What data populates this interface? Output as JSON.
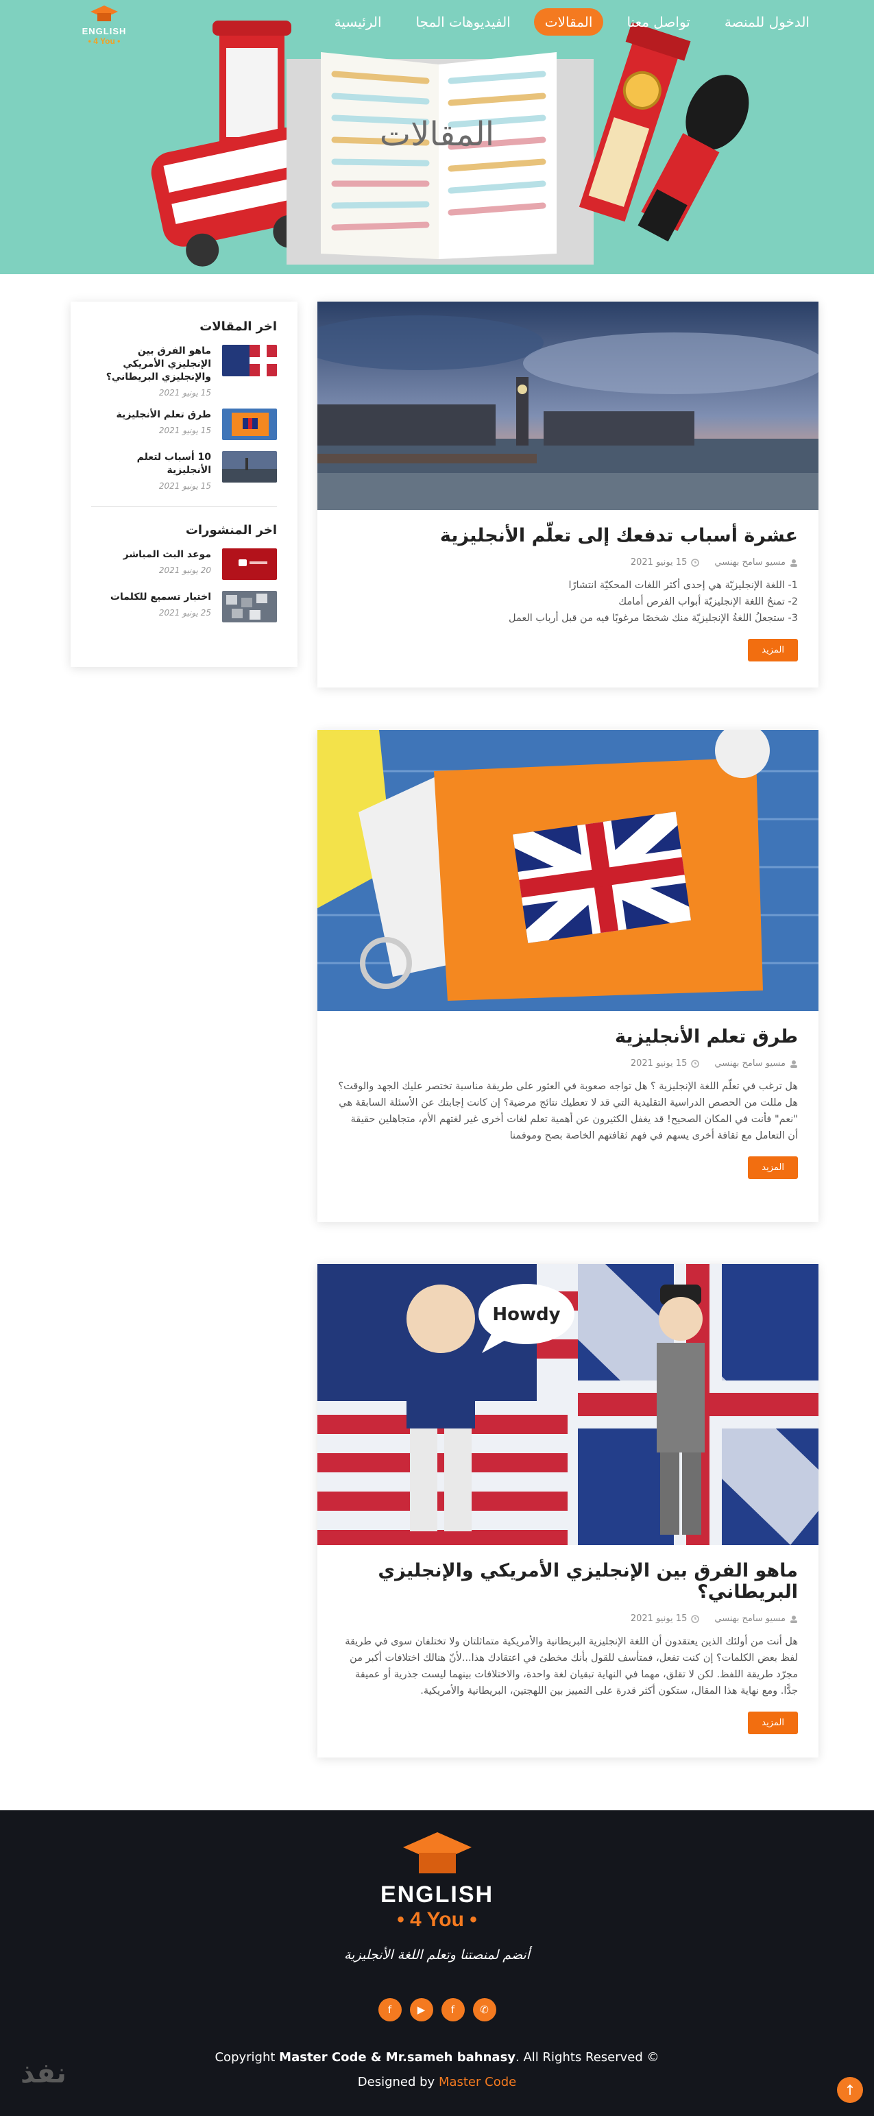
{
  "nav": {
    "items": [
      {
        "label": "الرئيسية"
      },
      {
        "label": "الفيديوهات المجا"
      },
      {
        "label": "المقالات",
        "active": true
      },
      {
        "label": "تواصل معنا"
      },
      {
        "label": "الدخول للمنصة"
      }
    ]
  },
  "logo": {
    "line1": "ENGLISH",
    "line2": "• 4 You •"
  },
  "hero": {
    "title": "المقالات"
  },
  "posts": [
    {
      "title": "عشرة أسباب تدفعك إلى تعلّم الأنجليزية",
      "author": "مسيو سامح بهنسي",
      "date": "15 يونيو 2021",
      "excerpt_lines": [
        "1- اللغة الإنجليزيّة هي إحدى أكثر اللغات المحكيّة انتشارًا",
        "2- تمنحُ اللغة الإنجليزيّة أبواب الفرص أمامك",
        "3- ستجعلُ اللغةُ الإنجليزيّة منك شخصًا مرغوبًا فيه من قبل أرباب العمل"
      ],
      "more": "المزيد"
    },
    {
      "title": "طرق تعلم الأنجليزية",
      "author": "مسيو سامح بهنسي",
      "date": "15 يونيو 2021",
      "excerpt": "هل ترغب في تعلّم اللغة الإنجليزية ؟ هل تواجه صعوبة في العثور على طريقة مناسبة تختصر عليك الجهد والوقت؟ هل مللت من الحصص الدراسية التقليدية التي قد لا تعطيك نتائج مرضية؟ إن كانت إجابتك عن الأسئلة السابقة هي \"نعم\" فأنت في المكان الصحيح! قد يغفل الكثيرون عن أهمية تعلم لغات أخرى غير لغتهم الأم، متجاهلين حقيقة أن التعامل مع ثقافة أخرى يسهم في فهم ثقافتهم الخاصة بصح وموفمنا",
      "more": "المزيد"
    },
    {
      "title": "ماهو الفرق بين الإنجليزي الأمريكي والإنجليزي البريطاني؟",
      "author": "مسيو سامح بهنسي",
      "date": "15 يونيو 2021",
      "excerpt": "هل أنت من أولئك الذين يعتقدون أن اللغة الإنجليزية البريطانية والأمريكية متماثلتان ولا تختلفان سوى في طريقة لفظ بعض الكلمات؟ إن كنت تفعل، فمتأسف للقول بأنك مخطئ في اعتقادك هذا...لأنّ هنالك اختلافات أكبر من مجرّد طريقة اللفظ. لكن لا تقلق، مهما في النهاية تبقيان لغة واحدة، والاختلافات بينهما ليست جذرية أو عميقة جدًّا. ومع نهاية هذا المقال، ستكون أكثر قدرة على التمييز بين اللهجتين، البريطانية والأمريكية.",
      "more": "المزيد",
      "bubble": "Howdy"
    }
  ],
  "sidebar": {
    "articles_heading": "اخر المقالات",
    "articles": [
      {
        "title": "ماهو الفرق بين الإنجليزي الأمريكي والإنجليزي البريطاني؟",
        "date": "15 يونيو 2021"
      },
      {
        "title": "طرق تعلم الأنجليزية",
        "date": "15 يونيو 2021"
      },
      {
        "title": "10 أسباب لتعلم الأنجليزية",
        "date": "15 يونيو 2021"
      }
    ],
    "posts_heading": "اخر المنشورات",
    "posts": [
      {
        "title": "موعد البث المباشر",
        "date": "20 يونيو 2021"
      },
      {
        "title": "اختبار تسميع للكلمات",
        "date": "25 يونيو 2021"
      }
    ]
  },
  "footer": {
    "logo_line1": "ENGLISH",
    "logo_line2": "• 4 You •",
    "tagline": "أنضم لمنصتنا وتعلم اللغة الأنجليزية",
    "social_icons": [
      "facebook-icon",
      "youtube-icon",
      "facebook-icon",
      "whatsapp-icon"
    ],
    "copy_prefix": "Copyright ",
    "copy_names": "Master Code & Mr.sameh bahnasy",
    "copy_suffix": ". All Rights Reserved ©",
    "design_prefix": "Designed by ",
    "design_name": "Master Code"
  },
  "watermark": "نفذ",
  "colors": {
    "accent": "#f47a20",
    "hero_bg": "#7fd1bf",
    "footer_bg": "#14161c"
  }
}
